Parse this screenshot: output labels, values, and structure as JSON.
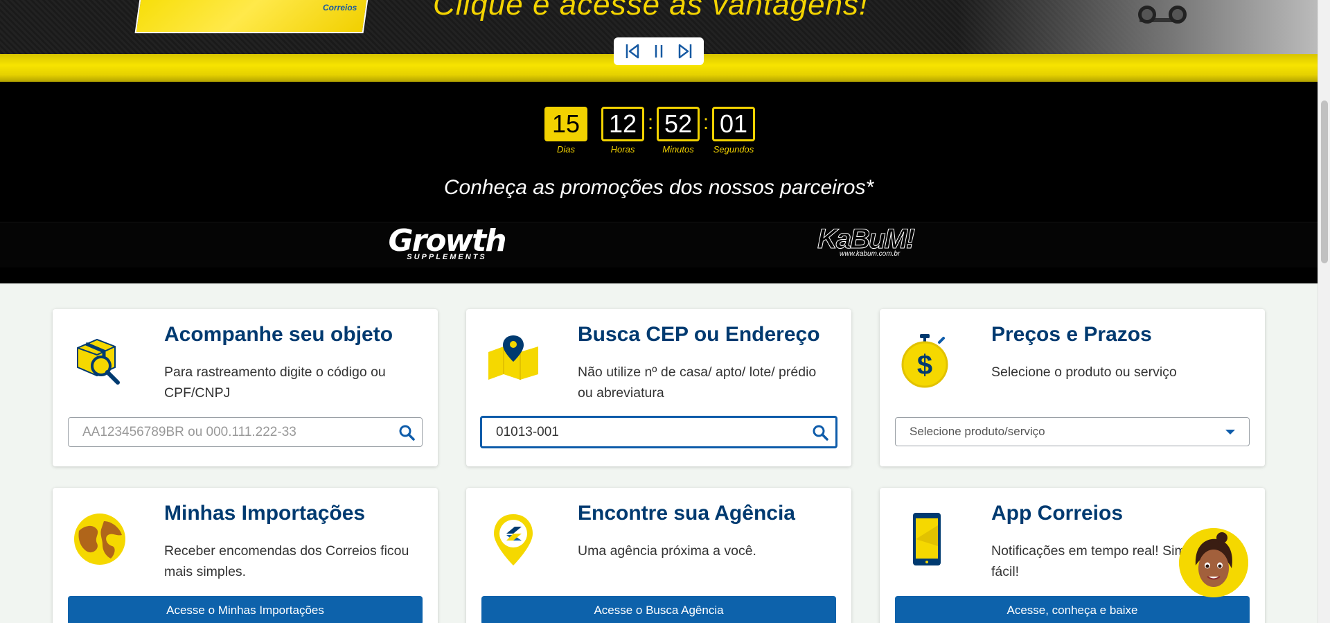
{
  "banner": {
    "headline": "Clique e acesse as vantagens!",
    "box_label": "Correios"
  },
  "carousel": {
    "prev_label": "Anterior",
    "pause_label": "Pausar",
    "next_label": "Próximo"
  },
  "countdown": {
    "units": [
      {
        "value": "15",
        "label": "Dias"
      },
      {
        "value": "12",
        "label": "Horas"
      },
      {
        "value": "52",
        "label": "Minutos"
      },
      {
        "value": "01",
        "label": "Segundos"
      }
    ],
    "separator": ":"
  },
  "promo": {
    "title": "Conheça as promoções dos nossos parceiros*",
    "partners": [
      {
        "name": "Growth",
        "sub": "SUPPLEMENTS"
      },
      {
        "name": "KaBuM!",
        "sub": "www.kabum.com.br"
      }
    ]
  },
  "cards": {
    "tracking": {
      "title": "Acompanhe seu objeto",
      "desc": "Para rastreamento digite o código ou CPF/CNPJ",
      "placeholder": "AA123456789BR ou 000.111.222-33",
      "value": ""
    },
    "cep": {
      "title": "Busca CEP ou Endereço",
      "desc": "Não utilize nº de casa/ apto/ lote/ prédio ou abreviatura",
      "placeholder": "",
      "value": "01013-001"
    },
    "prices": {
      "title": "Preços e Prazos",
      "desc": "Selecione o produto ou serviço",
      "select_value": "Selecione produto/serviço"
    },
    "imports": {
      "title": "Minhas Importações",
      "desc": "Receber encomendas dos Correios ficou mais simples.",
      "button": "Acesse o Minhas Importações"
    },
    "agency": {
      "title": "Encontre sua Agência",
      "desc": "Uma agência próxima a você.",
      "button": "Acesse o Busca Agência"
    },
    "app": {
      "title": "App Correios",
      "desc": "Notificações em tempo real! Simples e fácil!",
      "button": "Acesse, conheça e baixe"
    }
  },
  "colors": {
    "brand_yellow": "#f2d200",
    "brand_blue": "#003a70",
    "button_blue": "#0d62ab"
  },
  "icons": [
    "package-search-icon",
    "map-pin-icon",
    "stopwatch-dollar-icon",
    "globe-icon",
    "agency-pin-icon",
    "phone-icon",
    "search-icon"
  ]
}
